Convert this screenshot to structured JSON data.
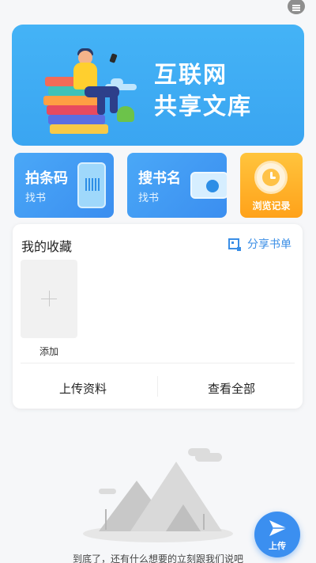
{
  "banner": {
    "title_line1": "互联网",
    "title_line2": "共享文库"
  },
  "quick_actions": {
    "barcode": {
      "title": "拍条码",
      "sub": "找书"
    },
    "search": {
      "title": "搜书名",
      "sub": "找书"
    },
    "history": {
      "label": "浏览记录"
    }
  },
  "collection": {
    "title": "我的收藏",
    "share_label": "分享书单",
    "add_label": "添加",
    "upload_label": "上传资料",
    "view_all_label": "查看全部"
  },
  "empty": {
    "message": "到底了，还有什么想要的立刻跟我们说吧"
  },
  "fab": {
    "label": "上传"
  },
  "colors": {
    "accent": "#3b8ff0",
    "banner": "#44b3f6",
    "history": "#ffb22e"
  },
  "icons": [
    "menu-icon",
    "barcode-icon",
    "search-icon",
    "clock-icon",
    "qr-icon",
    "plus-icon",
    "paper-plane-icon"
  ]
}
